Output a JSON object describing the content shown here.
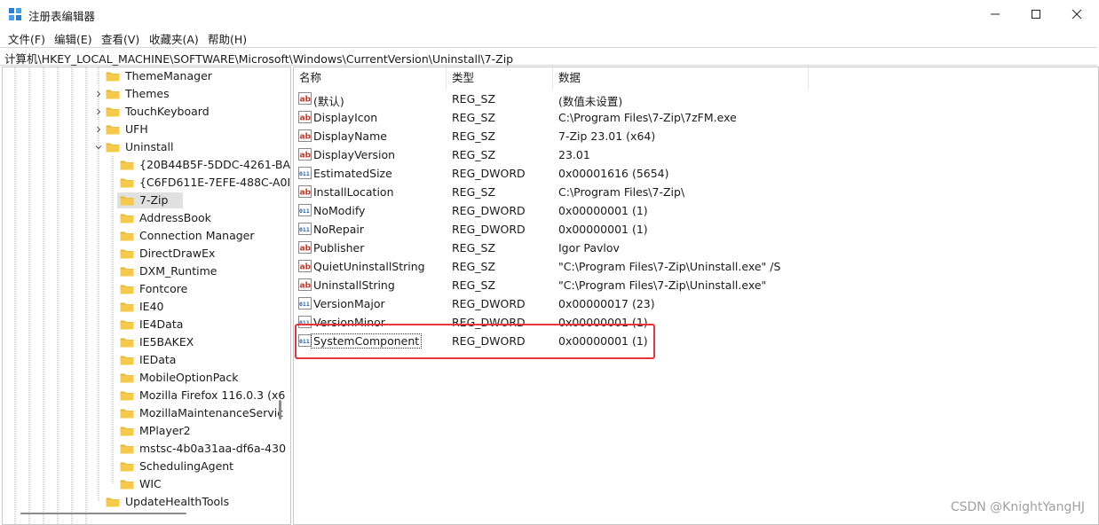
{
  "window": {
    "title": "注册表编辑器"
  },
  "menu": [
    "文件(F)",
    "编辑(E)",
    "查看(V)",
    "收藏夹(A)",
    "帮助(H)"
  ],
  "address": "计算机\\HKEY_LOCAL_MACHINE\\SOFTWARE\\Microsoft\\Windows\\CurrentVersion\\Uninstall\\7-Zip",
  "tree": [
    {
      "label": "ThemeManager",
      "level": 0,
      "expander": "none"
    },
    {
      "label": "Themes",
      "level": 0,
      "expander": "collapsed"
    },
    {
      "label": "TouchKeyboard",
      "level": 0,
      "expander": "collapsed"
    },
    {
      "label": "UFH",
      "level": 0,
      "expander": "collapsed"
    },
    {
      "label": "Uninstall",
      "level": 0,
      "expander": "expanded"
    },
    {
      "label": "{20B44B5F-5DDC-4261-BA",
      "level": 1,
      "expander": "none"
    },
    {
      "label": "{C6FD611E-7EFE-488C-A0I",
      "level": 1,
      "expander": "none"
    },
    {
      "label": "7-Zip",
      "level": 1,
      "expander": "none",
      "selected": true
    },
    {
      "label": "AddressBook",
      "level": 1,
      "expander": "none"
    },
    {
      "label": "Connection Manager",
      "level": 1,
      "expander": "none"
    },
    {
      "label": "DirectDrawEx",
      "level": 1,
      "expander": "none"
    },
    {
      "label": "DXM_Runtime",
      "level": 1,
      "expander": "none"
    },
    {
      "label": "Fontcore",
      "level": 1,
      "expander": "none"
    },
    {
      "label": "IE40",
      "level": 1,
      "expander": "none"
    },
    {
      "label": "IE4Data",
      "level": 1,
      "expander": "none"
    },
    {
      "label": "IE5BAKEX",
      "level": 1,
      "expander": "none"
    },
    {
      "label": "IEData",
      "level": 1,
      "expander": "none"
    },
    {
      "label": "MobileOptionPack",
      "level": 1,
      "expander": "none"
    },
    {
      "label": "Mozilla Firefox 116.0.3 (x6",
      "level": 1,
      "expander": "none"
    },
    {
      "label": "MozillaMaintenanceServic",
      "level": 1,
      "expander": "none"
    },
    {
      "label": "MPlayer2",
      "level": 1,
      "expander": "none"
    },
    {
      "label": "mstsc-4b0a31aa-df6a-430",
      "level": 1,
      "expander": "none"
    },
    {
      "label": "SchedulingAgent",
      "level": 1,
      "expander": "none"
    },
    {
      "label": "WIC",
      "level": 1,
      "expander": "none"
    },
    {
      "label": "UpdateHealthTools",
      "level": 0,
      "expander": "none"
    }
  ],
  "columns": {
    "name": "名称",
    "type": "类型",
    "data": "数据"
  },
  "values": [
    {
      "name": "(默认)",
      "type": "REG_SZ",
      "data": "(数值未设置)",
      "kind": "sz"
    },
    {
      "name": "DisplayIcon",
      "type": "REG_SZ",
      "data": "C:\\Program Files\\7-Zip\\7zFM.exe",
      "kind": "sz"
    },
    {
      "name": "DisplayName",
      "type": "REG_SZ",
      "data": "7-Zip 23.01 (x64)",
      "kind": "sz"
    },
    {
      "name": "DisplayVersion",
      "type": "REG_SZ",
      "data": "23.01",
      "kind": "sz"
    },
    {
      "name": "EstimatedSize",
      "type": "REG_DWORD",
      "data": "0x00001616 (5654)",
      "kind": "dword"
    },
    {
      "name": "InstallLocation",
      "type": "REG_SZ",
      "data": "C:\\Program Files\\7-Zip\\",
      "kind": "sz"
    },
    {
      "name": "NoModify",
      "type": "REG_DWORD",
      "data": "0x00000001 (1)",
      "kind": "dword"
    },
    {
      "name": "NoRepair",
      "type": "REG_DWORD",
      "data": "0x00000001 (1)",
      "kind": "dword"
    },
    {
      "name": "Publisher",
      "type": "REG_SZ",
      "data": "Igor Pavlov",
      "kind": "sz"
    },
    {
      "name": "QuietUninstallString",
      "type": "REG_SZ",
      "data": "\"C:\\Program Files\\7-Zip\\Uninstall.exe\" /S",
      "kind": "sz"
    },
    {
      "name": "UninstallString",
      "type": "REG_SZ",
      "data": "\"C:\\Program Files\\7-Zip\\Uninstall.exe\"",
      "kind": "sz"
    },
    {
      "name": "VersionMajor",
      "type": "REG_DWORD",
      "data": "0x00000017 (23)",
      "kind": "dword"
    },
    {
      "name": "VersionMinor",
      "type": "REG_DWORD",
      "data": "0x00000001 (1)",
      "kind": "dword"
    },
    {
      "name": "SystemComponent",
      "type": "REG_DWORD",
      "data": "0x00000001 (1)",
      "kind": "dword",
      "focused": true
    }
  ],
  "watermark": "CSDN @KnightYangHJ",
  "colors": {
    "folder": "#f7c94b",
    "highlight": "#e8343a",
    "reg_sz": "#c0392b",
    "reg_dword": "#1f5fae"
  }
}
